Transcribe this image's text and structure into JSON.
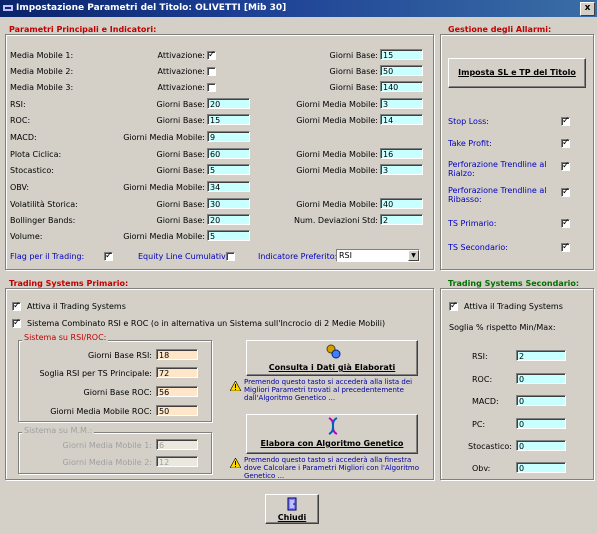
{
  "window": {
    "title": "Impostazione Parametri del Titolo:  OLIVETTI  [Mib 30]",
    "close": "x"
  },
  "indicators": {
    "heading": "Parametri Principali e Indicatori:",
    "mm1": {
      "label": "Media Mobile 1:",
      "attiv": "Attivazione:",
      "checked": "✓",
      "gb_label": "Giorni Base:",
      "gb": "15"
    },
    "mm2": {
      "label": "Media Mobile 2:",
      "attiv": "Attivazione:",
      "checked": "",
      "gb_label": "Giorni Base:",
      "gb": "50"
    },
    "mm3": {
      "label": "Media Mobile 3:",
      "attiv": "Attivazione:",
      "checked": "",
      "gb_label": "Giorni Base:",
      "gb": "140"
    },
    "rsi": {
      "label": "RSI:",
      "gb_label": "Giorni Base:",
      "gb": "20",
      "gmm_label": "Giorni Media Mobile:",
      "gmm": "3"
    },
    "roc": {
      "label": "ROC:",
      "gb_label": "Giorni Base:",
      "gb": "15",
      "gmm_label": "Giorni Media Mobile:",
      "gmm": "14"
    },
    "macd": {
      "label": "MACD:",
      "gmm_label": "Giorni Media Mobile:",
      "gmm": "9"
    },
    "pc": {
      "label": "Plota Ciclica:",
      "gb_label": "Giorni Base:",
      "gb": "60",
      "gmm_label": "Giorni Media Mobile:",
      "gmm": "16"
    },
    "sto": {
      "label": "Stocastico:",
      "gb_label": "Giorni Base:",
      "gb": "5",
      "gmm_label": "Giorni Media Mobile:",
      "gmm": "3"
    },
    "obv": {
      "label": "OBV:",
      "gmm_label": "Giorni Media Mobile:",
      "gmm": "34"
    },
    "vol": {
      "label": "Volatilità Storica:",
      "gb_label": "Giorni Base:",
      "gb": "30",
      "gmm_label": "Giorni Media Mobile:",
      "gmm": "40"
    },
    "bb": {
      "label": "Bollinger Bands:",
      "gb_label": "Giorni Base:",
      "gb": "20",
      "nds_label": "Num. Deviazioni Std:",
      "nds": "2"
    },
    "volume": {
      "label": "Volume:",
      "gmm_label": "Giorni Media Mobile:",
      "gmm": "5"
    },
    "flag_label": "Flag per il Trading:",
    "flag_checked": "✓",
    "equity_label": "Equity Line Cumulativa:",
    "equity_checked": "",
    "pref_label": "Indicatore Preferito:",
    "pref_value": "RSI"
  },
  "alarms": {
    "heading": "Gestione degli Allarmi:",
    "button": "Imposta SL e TP del Titolo",
    "items": [
      {
        "label": "Stop Loss:",
        "checked": "✓"
      },
      {
        "label": "Take Profit:",
        "checked": "✓"
      },
      {
        "label": "Perforazione Trendline al Rialzo:",
        "checked": "✓"
      },
      {
        "label": "Perforazione Trendline al Ribasso:",
        "checked": "✓"
      },
      {
        "label": "TS Primario:",
        "checked": "✓"
      },
      {
        "label": "TS Secondario:",
        "checked": "✓"
      }
    ]
  },
  "tsp": {
    "heading": "Trading Systems Primario:",
    "attiva_label": "Attiva il Trading Systems",
    "attiva_checked": "✓",
    "combo_label": "Sistema Combinato RSI e ROC  (o in alternativa un Sistema sull'Incrocio di 2 Medie Mobili)",
    "combo_checked": "✓",
    "rsiroc_heading": "Sistema su RSI/ROC:",
    "gb_rsi_label": "Giorni Base RSI:",
    "gb_rsi": "18",
    "soglia_label": "Soglia RSI per TS Principale:",
    "soglia": "72",
    "gb_roc_label": "Giorni Base ROC:",
    "gb_roc": "56",
    "gmm_roc_label": "Giorni Media Mobile ROC:",
    "gmm_roc": "50",
    "mm_heading": "Sistema su M.M.:",
    "gmm1_label": "Giorni Media Mobile 1:",
    "gmm1": "6",
    "gmm2_label": "Giorni Media Mobile 2:",
    "gmm2": "12",
    "consulta_button": "Consulta i Dati già Elaborati",
    "consulta_note": "Premendo questo tasto si accederà alla lista dei Migliori Parametri trovati al precedentemente dall'Algoritmo Genetico ...",
    "elabora_button": "Elabora con Algoritmo Genetico",
    "elabora_note": "Premendo questo tasto si accederà alla finestra dove Calcolare i Parametri Migliori con l'Algoritmo Genetico ..."
  },
  "tss": {
    "heading": "Trading Systems Secondario:",
    "attiva_label": "Attiva il Trading Systems",
    "attiva_checked": "✓",
    "soglia_label": "Soglia % rispetto Min/Max:",
    "rows": [
      {
        "label": "RSI:",
        "value": "2"
      },
      {
        "label": "ROC:",
        "value": "0"
      },
      {
        "label": "MACD:",
        "value": "0"
      },
      {
        "label": "PC:",
        "value": "0"
      },
      {
        "label": "Stocastico:",
        "value": "0"
      },
      {
        "label": "Obv:",
        "value": "0"
      }
    ]
  },
  "footer": {
    "close_button": "Chiudi"
  }
}
